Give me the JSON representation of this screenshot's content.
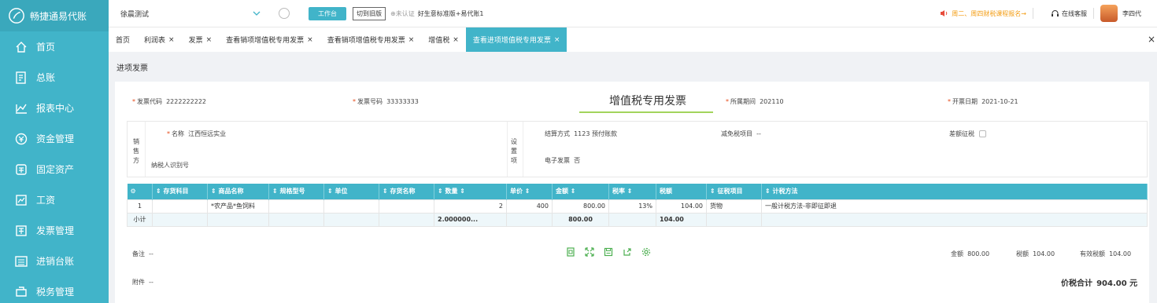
{
  "brand": {
    "name": "畅捷通易代账"
  },
  "sidebar": {
    "items": [
      {
        "label": "首页",
        "icon": "home-icon"
      },
      {
        "label": "总账",
        "icon": "ledger-icon"
      },
      {
        "label": "报表中心",
        "icon": "chart-icon"
      },
      {
        "label": "资金管理",
        "icon": "money-icon"
      },
      {
        "label": "固定资产",
        "icon": "asset-icon"
      },
      {
        "label": "工资",
        "icon": "salary-icon"
      },
      {
        "label": "发票管理",
        "icon": "invoice-icon"
      },
      {
        "label": "进销台账",
        "icon": "ledger-book-icon"
      },
      {
        "label": "税务管理",
        "icon": "tax-icon"
      }
    ]
  },
  "topbar": {
    "company": "徐晨测试",
    "workbench": "工作台",
    "switch_old": "切到旧版",
    "cert_status": "未认证",
    "package": "好生意标准版+易代账1",
    "notice": "周二、周四财税课程报名→",
    "service": "在线客服",
    "user": "李四代"
  },
  "tabs": [
    {
      "label": "首页",
      "closable": false,
      "active": false
    },
    {
      "label": "利润表",
      "closable": true,
      "active": false
    },
    {
      "label": "发票",
      "closable": true,
      "active": false
    },
    {
      "label": "查看销项增值税专用发票",
      "closable": true,
      "active": false
    },
    {
      "label": "查看销项增值税专用发票",
      "closable": true,
      "active": false
    },
    {
      "label": "增值税",
      "closable": true,
      "active": false
    },
    {
      "label": "查看进项增值税专用发票",
      "closable": true,
      "active": true
    }
  ],
  "page": {
    "section_title": "进项发票",
    "invoice_title": "增值税专用发票",
    "invoice_code_label": "发票代码",
    "invoice_code": "2222222222",
    "invoice_no_label": "发票号码",
    "invoice_no": "33333333",
    "period_label": "所属期间",
    "period": "202110",
    "date_label": "开票日期",
    "date": "2021-10-21",
    "seller_label": "销售方",
    "seller_name_label": "名称",
    "seller_name": "江西恒远实业",
    "taxpayer_id_label": "纳税人识别号",
    "settings_label": "设置项",
    "settlement_label": "结算方式",
    "settlement": "1123 预付账款",
    "exempt_label": "减免税项目",
    "exempt": "--",
    "diff_tax_label": "差额征税",
    "e_invoice_label": "电子发票",
    "e_invoice": "否",
    "remark_label": "备注",
    "remark": "--",
    "attachment_label": "附件",
    "attachment": "--",
    "amount_label": "金额",
    "amount": "800.00",
    "tax_label": "税额",
    "tax": "104.00",
    "valid_tax_label": "有效税额",
    "valid_tax": "104.00",
    "total_label": "价税合计",
    "total": "904.00 元"
  },
  "table": {
    "headers": [
      "",
      "存货科目",
      "商品名称",
      "规格型号",
      "单位",
      "存货名称",
      "数量",
      "单价",
      "金额",
      "税率",
      "税额",
      "征税项目",
      "计税方法"
    ],
    "rows": [
      [
        "1",
        "",
        "*农产品*鱼饲料",
        "",
        "",
        "",
        "2",
        "400",
        "800.00",
        "13%",
        "104.00",
        "货物",
        "一般计税方法-非即征即退"
      ]
    ],
    "subtotal": [
      "小计",
      "",
      "",
      "",
      "",
      "",
      "2.000000...",
      "",
      "800.00",
      "",
      "104.00",
      "",
      ""
    ]
  }
}
